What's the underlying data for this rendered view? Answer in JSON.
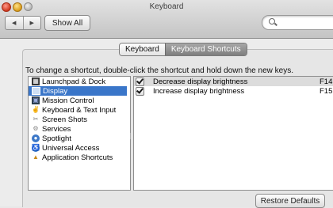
{
  "window": {
    "title": "Keyboard"
  },
  "toolbar": {
    "back_icon": "◀",
    "forward_icon": "▶",
    "show_all_label": "Show All"
  },
  "search": {
    "value": "",
    "placeholder": ""
  },
  "tabs": [
    {
      "label": "Keyboard",
      "selected": false
    },
    {
      "label": "Keyboard Shortcuts",
      "selected": true
    }
  ],
  "instruction": "To change a shortcut, double-click the shortcut and hold down the new keys.",
  "categories": [
    {
      "label": "Launchpad & Dock",
      "icon": "launchpad-icon",
      "selected": false
    },
    {
      "label": "Display",
      "icon": "display-icon",
      "selected": true
    },
    {
      "label": "Mission Control",
      "icon": "mission-control-icon",
      "selected": false
    },
    {
      "label": "Keyboard & Text Input",
      "icon": "keyboard-icon",
      "selected": false
    },
    {
      "label": "Screen Shots",
      "icon": "screenshot-icon",
      "selected": false
    },
    {
      "label": "Services",
      "icon": "services-icon",
      "selected": false
    },
    {
      "label": "Spotlight",
      "icon": "spotlight-icon",
      "selected": false
    },
    {
      "label": "Universal Access",
      "icon": "universal-access-icon",
      "selected": false
    },
    {
      "label": "Application Shortcuts",
      "icon": "app-shortcuts-icon",
      "selected": false
    }
  ],
  "shortcuts": [
    {
      "enabled": true,
      "name": "Decrease display brightness",
      "key": "F14"
    },
    {
      "enabled": true,
      "name": "Increase display brightness",
      "key": "F15"
    }
  ],
  "restore_label": "Restore Defaults",
  "colors": {
    "selection": "#3a76c9"
  }
}
